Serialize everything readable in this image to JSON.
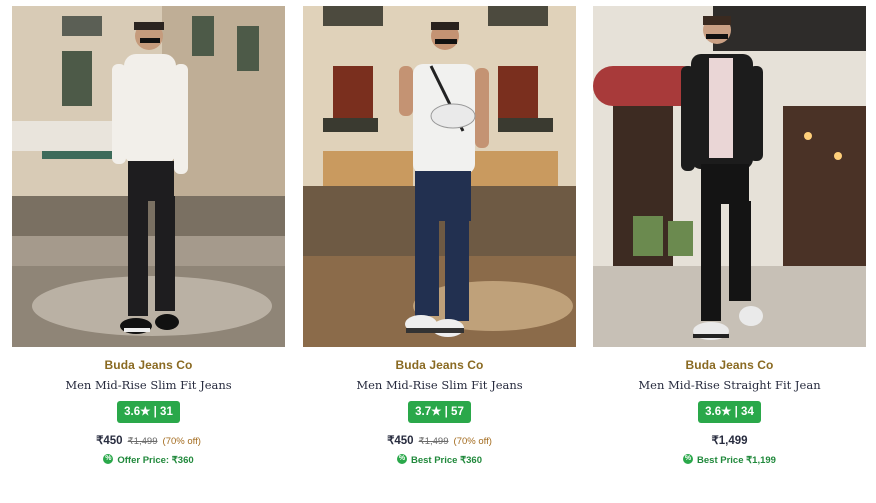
{
  "products": [
    {
      "brand": "Buda Jeans Co",
      "title": "Men Mid-Rise Slim Fit Jeans",
      "rating": "3.6★ | 31",
      "price": "₹450",
      "mrp": "₹1,499",
      "discount": "(70% off)",
      "offer": "Offer Price: ₹360"
    },
    {
      "brand": "Buda Jeans Co",
      "title": "Men Mid-Rise Slim Fit Jeans",
      "rating": "3.7★ | 57",
      "price": "₹450",
      "mrp": "₹1,499",
      "discount": "(70% off)",
      "offer": "Best Price ₹360"
    },
    {
      "brand": "Buda Jeans Co",
      "title": "Men Mid-Rise Straight Fit Jean",
      "rating": "3.6★ | 34",
      "price": "₹1,499",
      "mrp": "",
      "discount": "",
      "offer": "Best Price ₹1,199"
    }
  ],
  "colors": {
    "brand_text": "#8a6a22",
    "rating_badge": "#2aa84a",
    "offer_text": "#21893c",
    "discount_text": "#a36b1e"
  },
  "icons": {
    "offer": "percent-badge-icon"
  }
}
